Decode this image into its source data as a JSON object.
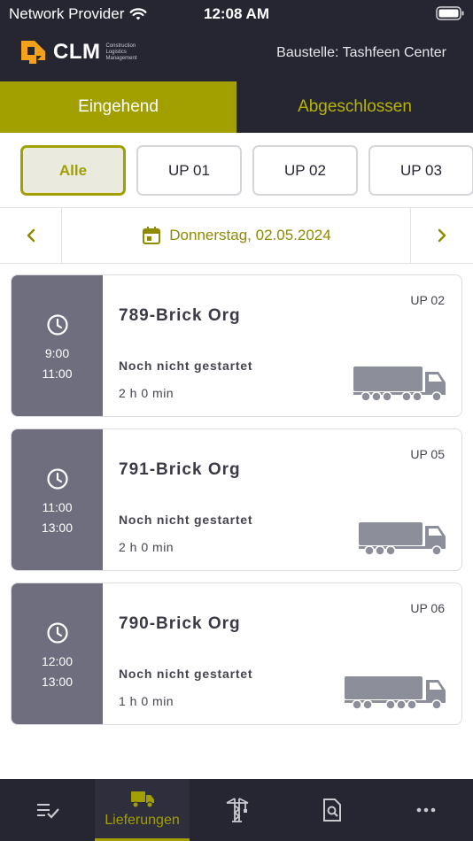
{
  "status_bar": {
    "carrier": "Network Provider",
    "time": "12:08 AM"
  },
  "header": {
    "logo_text": "CLM",
    "logo_subtitle_1": "Construction",
    "logo_subtitle_2": "Logistics",
    "logo_subtitle_3": "Management",
    "site_label": "Baustelle: Tashfeen Center"
  },
  "tabs": [
    {
      "label": "Eingehend",
      "active": true
    },
    {
      "label": "Abgeschlossen",
      "active": false
    }
  ],
  "filters": [
    {
      "label": "Alle",
      "active": true
    },
    {
      "label": "UP 01",
      "active": false
    },
    {
      "label": "UP 02",
      "active": false
    },
    {
      "label": "UP 03",
      "active": false
    }
  ],
  "date_bar": {
    "date": "Donnerstag, 02.05.2024",
    "prev_icon": "chevron-left-icon",
    "next_icon": "chevron-right-icon",
    "calendar_icon": "calendar-icon"
  },
  "deliveries": [
    {
      "title": "789-Brick Org",
      "start": "9:00",
      "end": "11:00",
      "status": "Noch nicht gestartet",
      "duration": "2 h 0 min",
      "up": "UP 02",
      "vehicle": "truck-trailer-icon"
    },
    {
      "title": "791-Brick Org",
      "start": "11:00",
      "end": "13:00",
      "status": "Noch nicht gestartet",
      "duration": "2 h 0 min",
      "up": "UP 05",
      "vehicle": "truck-icon"
    },
    {
      "title": "790-Brick Org",
      "start": "12:00",
      "end": "13:00",
      "status": "Noch nicht gestartet",
      "duration": "1 h 0 min",
      "up": "UP 06",
      "vehicle": "semi-truck-icon"
    }
  ],
  "bottom_nav": [
    {
      "icon": "checklist-icon",
      "label": ""
    },
    {
      "icon": "delivery-truck-icon",
      "label": "Lieferungen",
      "active": true
    },
    {
      "icon": "crane-icon",
      "label": ""
    },
    {
      "icon": "document-search-icon",
      "label": ""
    },
    {
      "icon": "more-icon",
      "label": ""
    }
  ],
  "colors": {
    "accent": "#a29f00",
    "dark": "#262633",
    "card_side": "#6e6e7e",
    "vehicle": "#8c8e99"
  }
}
